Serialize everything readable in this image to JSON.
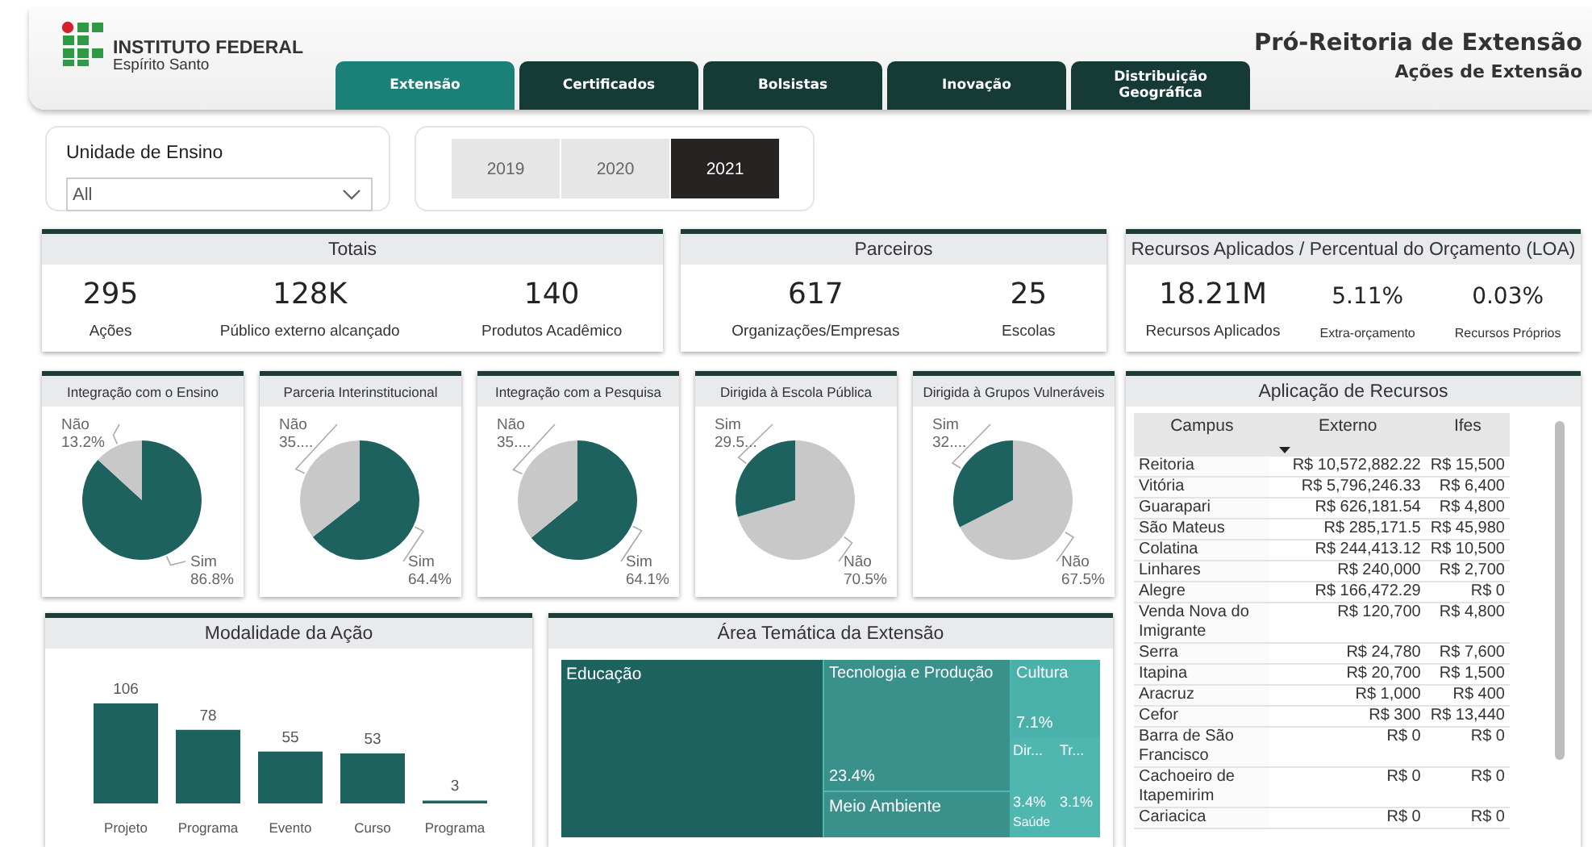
{
  "header": {
    "logo": {
      "name": "INSTITUTO FEDERAL",
      "subtitle": "Espírito Santo"
    },
    "tabs": [
      {
        "label": "Extensão",
        "selected": true
      },
      {
        "label": "Certificados",
        "selected": false
      },
      {
        "label": "Bolsistas",
        "selected": false
      },
      {
        "label": "Inovação",
        "selected": false
      },
      {
        "label": "Distribuição Geográfica",
        "selected": false
      }
    ],
    "title": "Pró-Reitoria de Extensão",
    "subtitle": "Ações de Extensão"
  },
  "filters": {
    "unit": {
      "label": "Unidade de Ensino",
      "value": "All"
    },
    "years": [
      {
        "label": "2019",
        "selected": false
      },
      {
        "label": "2020",
        "selected": false
      },
      {
        "label": "2021",
        "selected": true
      }
    ]
  },
  "kpi_cards": [
    {
      "title": "Totais",
      "kpis": [
        {
          "value": "295",
          "label": "Ações"
        },
        {
          "value": "128K",
          "label": "Público externo alcançado"
        },
        {
          "value": "140",
          "label": "Produtos Acadêmico"
        }
      ]
    },
    {
      "title": "Parceiros",
      "kpis": [
        {
          "value": "617",
          "label": "Organizações/Empresas"
        },
        {
          "value": "25",
          "label": "Escolas"
        }
      ]
    },
    {
      "title": "Recursos Aplicados / Percentual do Orçamento (LOA)",
      "kpis": [
        {
          "value": "18.21M",
          "label": "Recursos Aplicados"
        },
        {
          "value": "5.11%",
          "label": "Extra-orçamento"
        },
        {
          "value": "0.03%",
          "label": "Recursos Próprios"
        }
      ]
    }
  ],
  "pies": [
    {
      "title": "Integração com o Ensino",
      "chart_data": {
        "type": "pie",
        "categories": [
          "Sim",
          "Não"
        ],
        "values": [
          86.8,
          13.2
        ],
        "colors": [
          "#1e625f",
          "#c8c8c8"
        ],
        "value_labels": [
          "86.8%",
          "13.2%"
        ]
      }
    },
    {
      "title": "Parceria Interinstitucional",
      "chart_data": {
        "type": "pie",
        "categories": [
          "Sim",
          "Não"
        ],
        "values": [
          64.4,
          35.6
        ],
        "colors": [
          "#1e625f",
          "#c8c8c8"
        ],
        "value_labels": [
          "64.4%",
          "35...."
        ]
      }
    },
    {
      "title": "Integração com a Pesquisa",
      "chart_data": {
        "type": "pie",
        "categories": [
          "Sim",
          "Não"
        ],
        "values": [
          64.1,
          35.9
        ],
        "colors": [
          "#1e625f",
          "#c8c8c8"
        ],
        "value_labels": [
          "64.1%",
          "35...."
        ]
      }
    },
    {
      "title": "Dirigida à Escola Pública",
      "chart_data": {
        "type": "pie",
        "categories": [
          "Não",
          "Sim"
        ],
        "values": [
          70.5,
          29.5
        ],
        "colors": [
          "#c8c8c8",
          "#1e625f"
        ],
        "value_labels": [
          "70.5%",
          "29.5..."
        ]
      }
    },
    {
      "title": "Dirigida à Grupos Vulneráveis",
      "chart_data": {
        "type": "pie",
        "categories": [
          "Não",
          "Sim"
        ],
        "values": [
          67.5,
          32.5
        ],
        "colors": [
          "#c8c8c8",
          "#1e625f"
        ],
        "value_labels": [
          "67.5%",
          "32...."
        ]
      }
    }
  ],
  "modalidade": {
    "title": "Modalidade da Ação",
    "chart_data": {
      "type": "bar",
      "categories": [
        "Projeto",
        "Programa",
        "Evento",
        "Curso",
        "Programa"
      ],
      "values": [
        106,
        78,
        55,
        53,
        3
      ],
      "data_labels": true
    }
  },
  "area_tematica": {
    "title": "Área Temática da Extensão",
    "tiles": [
      {
        "label": "Educação"
      },
      {
        "label": "Tecnologia e Produção",
        "percent": "23.4%"
      },
      {
        "label": "Meio Ambiente"
      },
      {
        "label": "Cultura",
        "percent": "7.1%"
      },
      {
        "label": "Dir...",
        "percent": "3.4%"
      },
      {
        "label": "Tr...",
        "percent": "3.1%"
      },
      {
        "label": "Saúde"
      }
    ]
  },
  "table": {
    "title": "Aplicação de Recursos",
    "columns": [
      {
        "label": "Campus",
        "sorted": false
      },
      {
        "label": "Externo",
        "sorted": true
      },
      {
        "label": "Ifes",
        "sorted": false
      }
    ],
    "rows": [
      [
        "Reitoria",
        "R$ 10,572,882.22",
        "R$ 15,500"
      ],
      [
        "Vitória",
        "R$ 5,796,246.33",
        "R$ 6,400"
      ],
      [
        "Guarapari",
        "R$ 626,181.54",
        "R$ 4,800"
      ],
      [
        "São Mateus",
        "R$ 285,171.5",
        "R$ 45,980"
      ],
      [
        "Colatina",
        "R$ 244,413.12",
        "R$ 10,500"
      ],
      [
        "Linhares",
        "R$ 240,000",
        "R$ 2,700"
      ],
      [
        "Alegre",
        "R$ 166,472.29",
        "R$ 0"
      ],
      [
        "Venda Nova do Imigrante",
        "R$ 120,700",
        "R$ 4,800"
      ],
      [
        "Serra",
        "R$ 24,780",
        "R$ 7,600"
      ],
      [
        "Itapina",
        "R$ 20,700",
        "R$ 1,500"
      ],
      [
        "Aracruz",
        "R$ 1,000",
        "R$ 400"
      ],
      [
        "Cefor",
        "R$ 300",
        "R$ 13,440"
      ],
      [
        "Barra de São Francisco",
        "R$ 0",
        "R$ 0"
      ],
      [
        "Cachoeiro de Itapemirim",
        "R$ 0",
        "R$ 0"
      ],
      [
        "Cariacica",
        "R$ 0",
        "R$ 0"
      ]
    ]
  }
}
